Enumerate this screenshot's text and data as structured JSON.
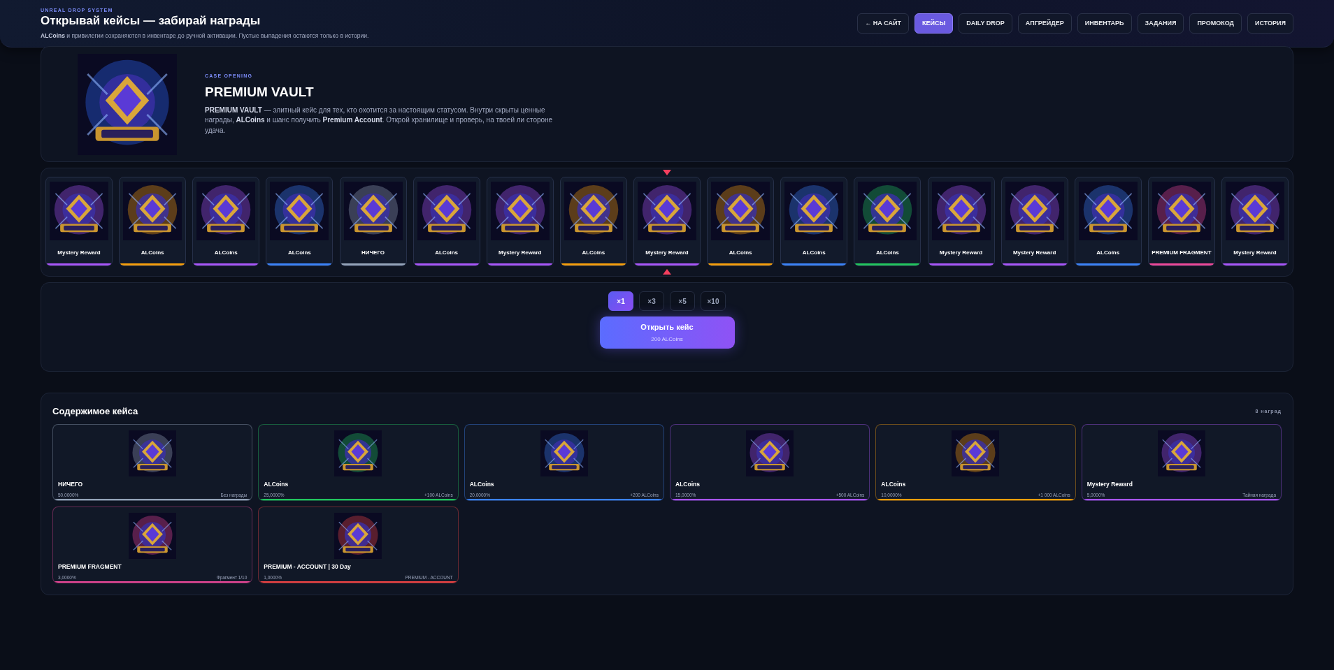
{
  "header": {
    "eyebrow": "UNREAL DROP SYSTEM",
    "title": "Открывай кейсы — забирай награды",
    "subtitle": "**ALCoins** и привилегии сохраняются в инвентаре до ручной активации. Пустые выпадения остаются только в истории."
  },
  "nav": [
    {
      "label": "← НА САЙТ",
      "selected": false
    },
    {
      "label": "КЕЙСЫ",
      "selected": true
    },
    {
      "label": "DAILY DROP",
      "selected": false
    },
    {
      "label": "АПГРЕЙДЕР",
      "selected": false
    },
    {
      "label": "ИНВЕНТАРЬ",
      "selected": false
    },
    {
      "label": "ЗАДАНИЯ",
      "selected": false
    },
    {
      "label": "ПРОМОКОД",
      "selected": false
    },
    {
      "label": "ИСТОРИЯ",
      "selected": false
    }
  ],
  "case": {
    "eyebrow": "CASE OPENING",
    "title": "PREMIUM VAULT",
    "description": "**PREMIUM VAULT** — элитный кейс для тех, кто охотится за настоящим статусом. Внутри скрыты ценные награды, **ALCoins** и шанс получить **Premium Account**. Открой хранилище и проверь, на твоей ли стороне удача."
  },
  "roulette": {
    "items": [
      {
        "label": "Mystery Reward",
        "color": "#a855f7"
      },
      {
        "label": "ALCoins",
        "color": "#f59e0b"
      },
      {
        "label": "ALCoins",
        "color": "#a855f7"
      },
      {
        "label": "ALCoins",
        "color": "#3b82f6"
      },
      {
        "label": "НИЧЕГО",
        "color": "#94a3b8"
      },
      {
        "label": "ALCoins",
        "color": "#a855f7"
      },
      {
        "label": "Mystery Reward",
        "color": "#a855f7"
      },
      {
        "label": "ALCoins",
        "color": "#f59e0b"
      },
      {
        "label": "Mystery Reward",
        "color": "#a855f7"
      },
      {
        "label": "ALCoins",
        "color": "#f59e0b"
      },
      {
        "label": "ALCoins",
        "color": "#3b82f6"
      },
      {
        "label": "ALCoins",
        "color": "#22c55e"
      },
      {
        "label": "Mystery Reward",
        "color": "#a855f7"
      },
      {
        "label": "Mystery Reward",
        "color": "#a855f7"
      },
      {
        "label": "ALCoins",
        "color": "#3b82f6"
      },
      {
        "label": "PREMIUM FRAGMENT",
        "color": "#ec4899"
      },
      {
        "label": "Mystery Reward",
        "color": "#a855f7"
      }
    ]
  },
  "multipliers": [
    {
      "label": "×1",
      "selected": true
    },
    {
      "label": "×3",
      "selected": false
    },
    {
      "label": "×5",
      "selected": false
    },
    {
      "label": "×10",
      "selected": false
    }
  ],
  "open_button": {
    "label": "Открыть кейс",
    "price": "200 ALCoins"
  },
  "contents": {
    "title": "Содержимое кейса",
    "count": "8 наград",
    "items": [
      {
        "name": "НИЧЕГО",
        "chance": "50,0000%",
        "reward": "Без награды",
        "color": "#94a3b8"
      },
      {
        "name": "ALCoins",
        "chance": "25,0000%",
        "reward": "+100 ALCoins",
        "color": "#22c55e"
      },
      {
        "name": "ALCoins",
        "chance": "20,0000%",
        "reward": "+200 ALCoins",
        "color": "#3b82f6"
      },
      {
        "name": "ALCoins",
        "chance": "15,0000%",
        "reward": "+500 ALCoins",
        "color": "#a855f7"
      },
      {
        "name": "ALCoins",
        "chance": "10,0000%",
        "reward": "+1 000 ALCoins",
        "color": "#f59e0b"
      },
      {
        "name": "Mystery Reward",
        "chance": "5,0000%",
        "reward": "Тайная награда",
        "color": "#a855f7"
      },
      {
        "name": "PREMIUM FRAGMENT",
        "chance": "3,0000%",
        "reward": "Фрагмент 1/10",
        "color": "#ec4899"
      },
      {
        "name": "PREMIUM - ACCOUNT | 30 Day",
        "chance": "1,0000%",
        "reward": "PREMIUM - ACCOUNT",
        "color": "#ef4444"
      }
    ]
  }
}
